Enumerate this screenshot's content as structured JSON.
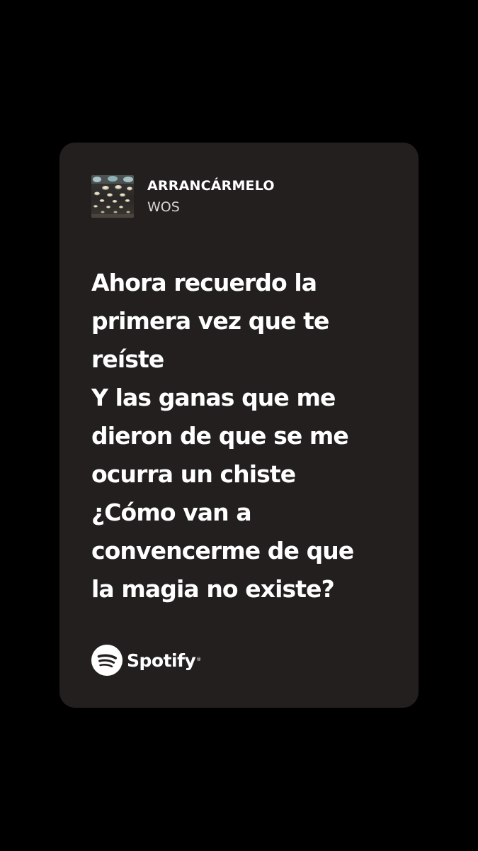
{
  "card": {
    "background": "#231f1f",
    "song": {
      "title": "ARRANCÁRMELO",
      "artist": "WOS",
      "cover_icon": "album-cover-ceiling-lights"
    },
    "lyrics": [
      "Ahora recuerdo la",
      "primera vez que te",
      "reíste",
      "Y las ganas que me",
      "dieron de que se me",
      "ocurra un chiste",
      "¿Cómo van a",
      "convencerme de que",
      "la magia no existe?"
    ],
    "brand": {
      "name": "Spotify",
      "registered": "®",
      "icon": "spotify-logo-icon"
    }
  }
}
